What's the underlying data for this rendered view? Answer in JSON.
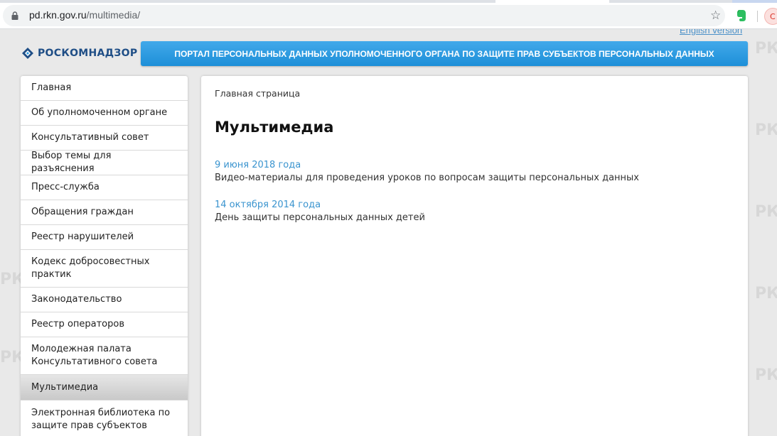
{
  "browser": {
    "url_host": "pd.rkn.gov.ru",
    "url_path": "/multimedia/",
    "profile_initial": "C"
  },
  "header": {
    "english_link": "English version",
    "logo_text": "РОСКОМНАДЗОР",
    "banner_text": "ПОРТАЛ ПЕРСОНАЛЬНЫХ ДАННЫХ УПОЛНОМОЧЕННОГО ОРГАНА ПО ЗАЩИТЕ ПРАВ СУБЪЕКТОВ ПЕРСОНАЛЬНЫХ ДАННЫХ",
    "watermark": "РКН"
  },
  "sidebar": {
    "items": [
      {
        "label": "Главная"
      },
      {
        "label": "Об уполномоченном органе"
      },
      {
        "label": "Консультативный совет"
      },
      {
        "label": "Выбор темы для разъяснения"
      },
      {
        "label": "Пресс-служба"
      },
      {
        "label": "Обращения граждан"
      },
      {
        "label": "Реестр нарушителей"
      },
      {
        "label": "Кодекс добросовестных практик"
      },
      {
        "label": "Законодательство"
      },
      {
        "label": "Реестр операторов"
      },
      {
        "label": "Молодежная палата Консультативного совета"
      },
      {
        "label": "Мультимедиа",
        "active": true
      },
      {
        "label": "Электронная библиотека по защите прав субъектов"
      }
    ]
  },
  "main": {
    "breadcrumb": "Главная страница",
    "title": "Мультимедиа",
    "news": [
      {
        "date": "9 июня 2018 года",
        "text": "Видео-материалы для проведения уроков по вопросам защиты персональных данных"
      },
      {
        "date": "14 октября 2014 года",
        "text": "День защиты персональных данных детей"
      }
    ]
  },
  "colors": {
    "accent": "#3a94cf",
    "banner": "#2a9be2",
    "logo": "#1f4e86"
  }
}
